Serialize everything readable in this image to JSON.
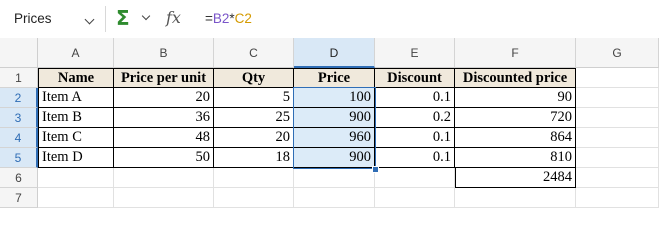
{
  "formula_bar": {
    "name_box": "Prices",
    "formula_prefix": "=",
    "formula_ref1": "B2",
    "formula_op": "*",
    "formula_ref2": "C2"
  },
  "columns": [
    "A",
    "B",
    "C",
    "D",
    "E",
    "F",
    "G"
  ],
  "rows": [
    "1",
    "2",
    "3",
    "4",
    "5",
    "6",
    "7"
  ],
  "table": {
    "headers": [
      "Name",
      "Price per unit",
      "Qty",
      "Price",
      "Discount",
      "Discounted price"
    ],
    "data": [
      [
        "Item A",
        "20",
        "5",
        "100",
        "0.1",
        "90"
      ],
      [
        "Item B",
        "36",
        "25",
        "900",
        "0.2",
        "720"
      ],
      [
        "Item C",
        "48",
        "20",
        "960",
        "0.1",
        "864"
      ],
      [
        "Item D",
        "50",
        "18",
        "900",
        "0.1",
        "810"
      ]
    ],
    "total": "2484"
  },
  "colors": {
    "accent": "#2f6db5",
    "header_fill": "#f0e9dc",
    "selection_fill": "#dcebf8",
    "ref1": "#7a55c9",
    "ref2": "#d49a00"
  }
}
